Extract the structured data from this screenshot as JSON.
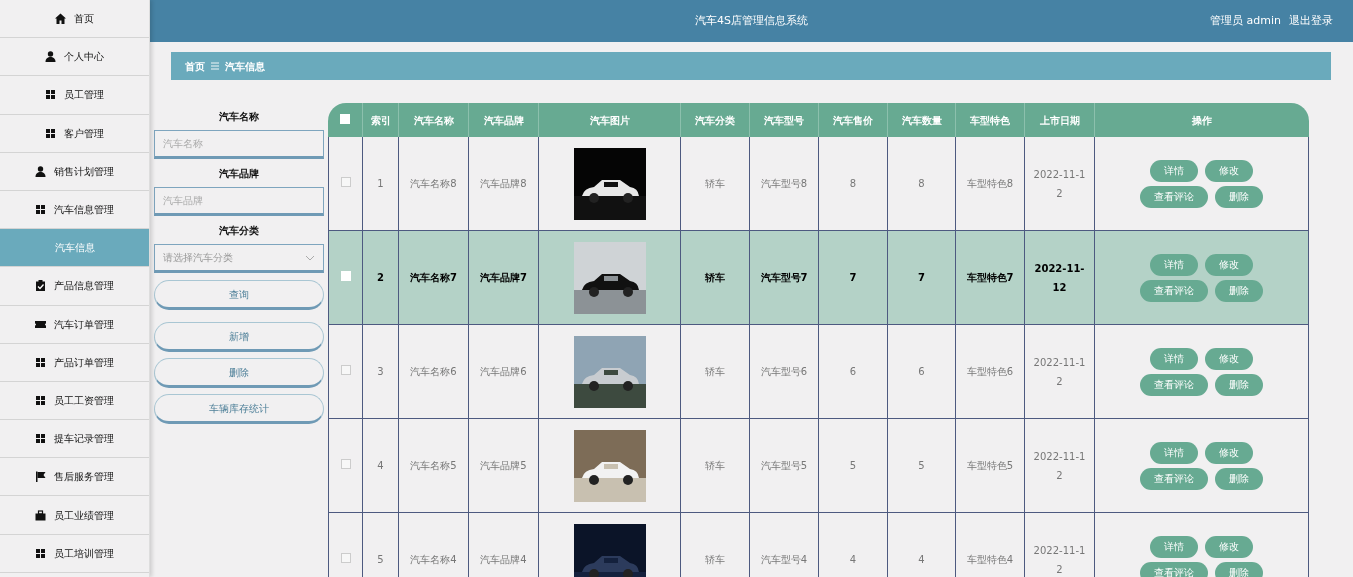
{
  "header": {
    "title": "汽车4S店管理信息系统",
    "user": "管理员 admin",
    "logout": "退出登录"
  },
  "sidebar": {
    "items": [
      {
        "label": "首页",
        "kind": "home",
        "selected": false
      },
      {
        "label": "个人中心",
        "kind": "user",
        "selected": false
      },
      {
        "label": "员工管理",
        "kind": "grid",
        "selected": false
      },
      {
        "label": "客户管理",
        "kind": "grid",
        "selected": false
      },
      {
        "label": "销售计划管理",
        "kind": "user",
        "selected": false
      },
      {
        "label": "汽车信息管理",
        "kind": "grid",
        "selected": false
      },
      {
        "label": "汽车信息",
        "kind": "sub",
        "selected": true
      },
      {
        "label": "产品信息管理",
        "kind": "clipboard",
        "selected": false
      },
      {
        "label": "汽车订单管理",
        "kind": "ticket",
        "selected": false
      },
      {
        "label": "产品订单管理",
        "kind": "grid",
        "selected": false
      },
      {
        "label": "员工工资管理",
        "kind": "grid",
        "selected": false
      },
      {
        "label": "提车记录管理",
        "kind": "grid",
        "selected": false
      },
      {
        "label": "售后服务管理",
        "kind": "flag",
        "selected": false
      },
      {
        "label": "员工业绩管理",
        "kind": "briefcase",
        "selected": false
      },
      {
        "label": "员工培训管理",
        "kind": "grid",
        "selected": false
      }
    ]
  },
  "breadcrumb": [
    "首页",
    "汽车信息"
  ],
  "filters": [
    {
      "label": "汽车名称",
      "kind": "input",
      "placeholder": "汽车名称"
    },
    {
      "label": "汽车品牌",
      "kind": "input",
      "placeholder": "汽车品牌"
    },
    {
      "label": "汽车分类",
      "kind": "select",
      "placeholder": "请选择汽车分类"
    }
  ],
  "search_button": "查询",
  "buttons": [
    "新增",
    "删除",
    "车辆库存统计"
  ],
  "table": {
    "checked": false,
    "columns": [
      "索引",
      "汽车名称",
      "汽车品牌",
      "汽车图片",
      "汽车分类",
      "汽车型号",
      "汽车售价",
      "汽车数量",
      "车型特色",
      "上市日期",
      "操作"
    ],
    "rows": [
      {
        "selected": false,
        "checked": false,
        "cells": [
          "1",
          "汽车名称8",
          "汽车品牌8",
          "",
          "轿车",
          "汽车型号8",
          "8",
          "8",
          "车型特色8",
          "2022-11-12"
        ],
        "actions": [
          "详情",
          "修改",
          "查看评论",
          "删除"
        ]
      },
      {
        "selected": true,
        "checked": false,
        "cells": [
          "2",
          "汽车名称7",
          "汽车品牌7",
          "",
          "轿车",
          "汽车型号7",
          "7",
          "7",
          "车型特色7",
          "2022-11-12"
        ],
        "actions": [
          "详情",
          "修改",
          "查看评论",
          "删除"
        ]
      },
      {
        "selected": false,
        "checked": false,
        "cells": [
          "3",
          "汽车名称6",
          "汽车品牌6",
          "",
          "轿车",
          "汽车型号6",
          "6",
          "6",
          "车型特色6",
          "2022-11-12"
        ],
        "actions": [
          "详情",
          "修改",
          "查看评论",
          "删除"
        ]
      },
      {
        "selected": false,
        "checked": false,
        "cells": [
          "4",
          "汽车名称5",
          "汽车品牌5",
          "",
          "轿车",
          "汽车型号5",
          "5",
          "5",
          "车型特色5",
          "2022-11-12"
        ],
        "actions": [
          "详情",
          "修改",
          "查看评论",
          "删除"
        ]
      },
      {
        "selected": false,
        "checked": false,
        "cells": [
          "5",
          "汽车名称4",
          "汽车品牌4",
          "",
          "轿车",
          "汽车型号4",
          "4",
          "4",
          "车型特色4",
          "2022-11-12"
        ],
        "actions": [
          "详情",
          "修改",
          "查看评论",
          "删除"
        ]
      }
    ]
  }
}
